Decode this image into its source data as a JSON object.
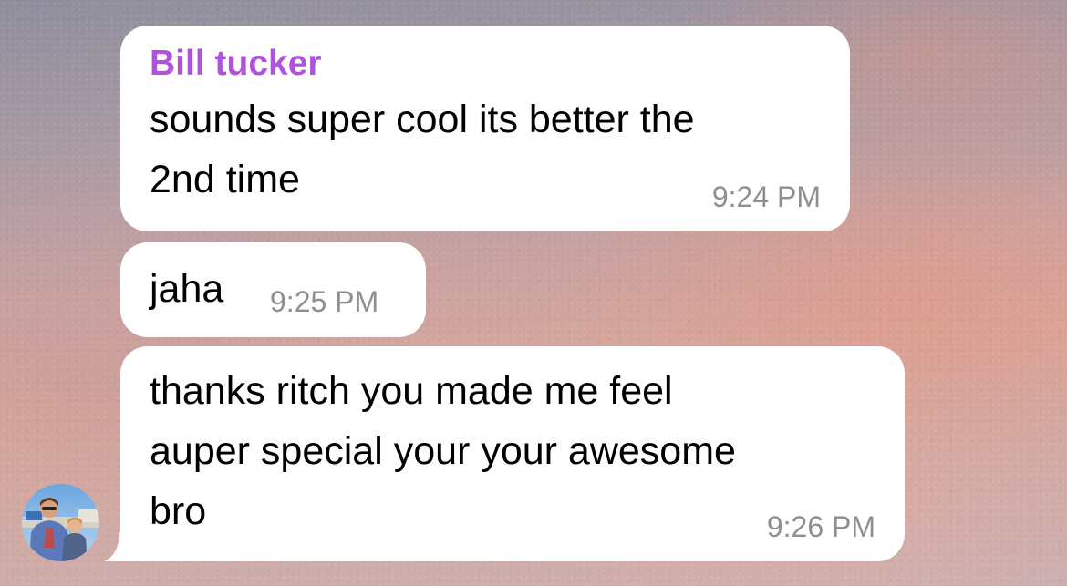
{
  "chat": {
    "messages": [
      {
        "sender": "Bill tucker",
        "text": "sounds super cool its better the\n2nd time",
        "time": "9:24 PM"
      },
      {
        "text": "jaha",
        "time": "9:25 PM"
      },
      {
        "text": "thanks ritch you made me feel\nauper special your your awesome\nbro",
        "time": "9:26 PM"
      }
    ],
    "sender_avatar_icon": "user-avatar-photo"
  },
  "colors": {
    "sender_name": "#af52de",
    "bubble_bg": "#ffffff",
    "timestamp": "#8e8e93"
  }
}
